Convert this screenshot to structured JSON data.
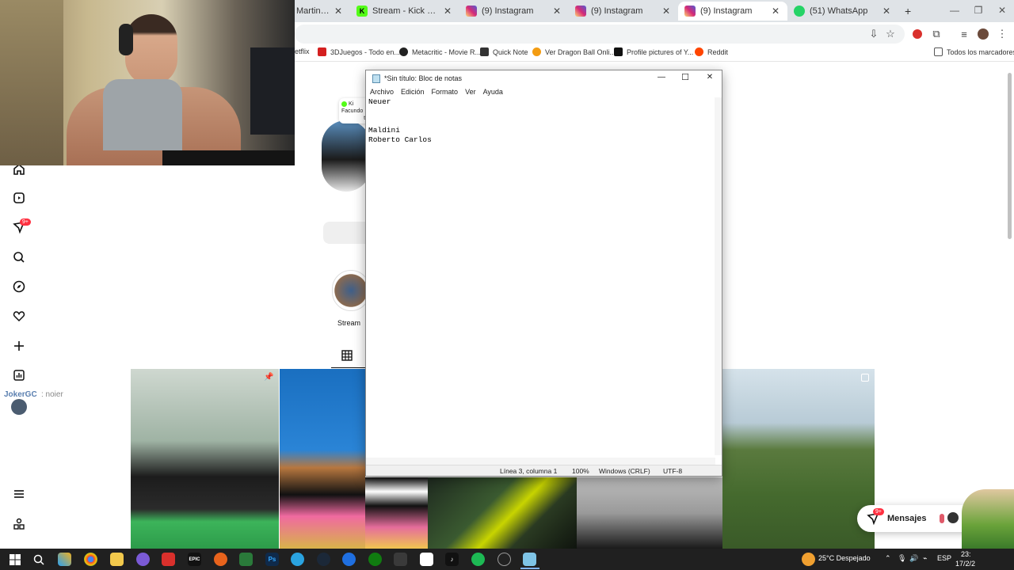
{
  "browser": {
    "tabs": [
      {
        "label": "Martinpdisa",
        "color": "#c0392b",
        "glyph": ""
      },
      {
        "label": "Stream - Kick Dashboard",
        "color": "#53fc18",
        "glyph": "K"
      },
      {
        "label": "(9) Instagram",
        "color": "#d6249f",
        "glyph": ""
      },
      {
        "label": "(9) Instagram",
        "color": "#d6249f",
        "glyph": ""
      },
      {
        "label": "(9) Instagram",
        "color": "#d6249f",
        "glyph": ""
      },
      {
        "label": "(51) WhatsApp",
        "color": "#25d366",
        "glyph": ""
      }
    ],
    "new_tab": "+",
    "window_controls": {
      "minimize": "—",
      "restore": "❐",
      "close": "✕"
    },
    "bookmarks": [
      {
        "label": "etflix",
        "color": "#e50914"
      },
      {
        "label": "3DJuegos - Todo en...",
        "color": "#d42020"
      },
      {
        "label": "Metacritic - Movie R...",
        "color": "#222222"
      },
      {
        "label": "Quick Note",
        "color": "#333333"
      },
      {
        "label": "Ver Dragon Ball Onli...",
        "color": "#f39c12"
      },
      {
        "label": "Profile pictures of Y...",
        "color": "#111111"
      },
      {
        "label": "Reddit",
        "color": "#ff4500"
      }
    ],
    "bookmarks_folder": "Todos los marcadores"
  },
  "instagram": {
    "notifications_badge": "9+",
    "live_card": {
      "line1": "Ki",
      "line2": "Facundo",
      "line3": "te"
    },
    "highlight_label": "Stream",
    "overlay_user": "JokerGC",
    "overlay_text": ": noier",
    "messages_label": "Mensajes",
    "messages_badge": "9+"
  },
  "notepad": {
    "title": "*Sin título: Bloc de notas",
    "menu": [
      "Archivo",
      "Edición",
      "Formato",
      "Ver",
      "Ayuda"
    ],
    "content": "Neuer\n\n\nMaldini\nRoberto Carlos",
    "status": {
      "position": "Línea 3, columna 1",
      "zoom": "100%",
      "line_ending": "Windows (CRLF)",
      "encoding": "UTF-8"
    },
    "controls": {
      "minimize": "—",
      "maximize": "☐",
      "close": "✕"
    }
  },
  "taskbar": {
    "weather": "25°C  Despejado",
    "language": "ESP",
    "time": "23:",
    "date": "17/2/2"
  }
}
